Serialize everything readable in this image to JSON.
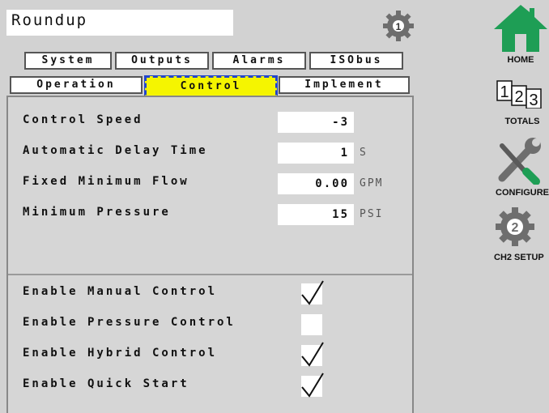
{
  "header": {
    "title": "Roundup"
  },
  "tabs_top": [
    "System",
    "Outputs",
    "Alarms",
    "ISObus"
  ],
  "tabs_bottom": [
    "Operation",
    "Control",
    "Implement"
  ],
  "active_tab": "Control",
  "settings": [
    {
      "label": "Control Speed",
      "value": "-3",
      "unit": ""
    },
    {
      "label": "Automatic Delay Time",
      "value": "1",
      "unit": "S"
    },
    {
      "label": "Fixed Minimum Flow",
      "value": "0.00",
      "unit": "GPM"
    },
    {
      "label": "Minimum Pressure",
      "value": "15",
      "unit": "PSI"
    }
  ],
  "toggles": [
    {
      "label": "Enable Manual Control",
      "checked": true
    },
    {
      "label": "Enable Pressure Control",
      "checked": false
    },
    {
      "label": "Enable Hybrid Control",
      "checked": true
    },
    {
      "label": "Enable Quick Start",
      "checked": true
    }
  ],
  "sidebar": {
    "home": "HOME",
    "totals": "TOTALS",
    "totals_digits": [
      "1",
      "2",
      "3"
    ],
    "configure": "CONFIGURE",
    "ch2_setup": "CH2 SETUP",
    "ch2_number": "2"
  },
  "gear_badge": "1",
  "colors": {
    "active_tab": "#f5f500",
    "active_border": "#2244cc",
    "home_green": "#1e9e55",
    "gear_gray": "#6e6e6e"
  }
}
